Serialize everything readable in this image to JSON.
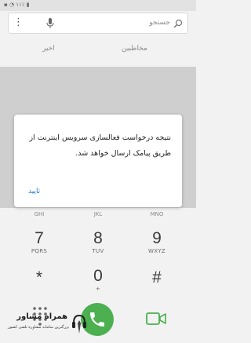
{
  "status_bar": {
    "indicators": "▪ ◔ ۱۱٪ ▮"
  },
  "search": {
    "label": "جستجو",
    "icons": [
      "more-icon",
      "mic-icon",
      "search-icon"
    ]
  },
  "tabs": [
    {
      "label": "مخاطبین"
    },
    {
      "label": "اخیر"
    }
  ],
  "dialog": {
    "message": "نتیجه درخواست فعالسازی سرویس اینترنت از طریق پیامک ارسال خواهد شد.",
    "ok_label": "تایید"
  },
  "keypad": {
    "partial_letters": [
      "GHI",
      "JKL",
      "MNO"
    ],
    "keys": [
      {
        "digit": "7",
        "letters": "PQRS"
      },
      {
        "digit": "8",
        "letters": "TUV"
      },
      {
        "digit": "9",
        "letters": "WXYZ"
      },
      {
        "digit": "*",
        "letters": ""
      },
      {
        "digit": "0",
        "letters": "+"
      },
      {
        "digit": "#",
        "letters": ""
      }
    ]
  },
  "bottom_bar": {
    "icons": [
      "dialpad-icon",
      "phone-icon",
      "video-call-icon"
    ],
    "call_color": "#4caf50"
  },
  "watermark": {
    "brand": "همراه مشاور",
    "tagline": "بزرگترین سامانه مشاوره تلفنی کشور"
  },
  "colors": {
    "accent": "#2a7ad3",
    "call_green": "#4caf50",
    "video_green": "#4caf50"
  }
}
